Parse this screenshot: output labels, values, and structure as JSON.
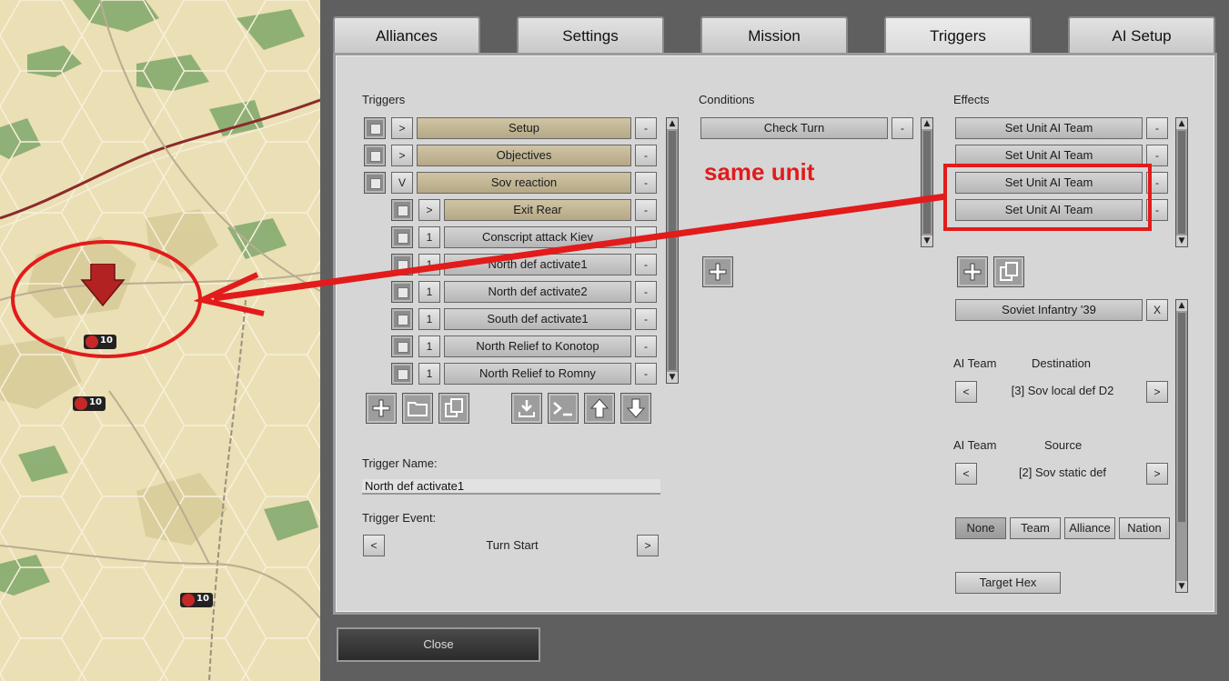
{
  "tabs": [
    {
      "label": "Alliances"
    },
    {
      "label": "Settings"
    },
    {
      "label": "Mission"
    },
    {
      "label": "Triggers"
    },
    {
      "label": "AI Setup"
    }
  ],
  "active_tab": "Triggers",
  "triggers": {
    "title": "Triggers",
    "items": [
      {
        "expander": ">",
        "label": "Setup",
        "style": "tan",
        "indent": false
      },
      {
        "expander": ">",
        "label": "Objectives",
        "style": "tan",
        "indent": false
      },
      {
        "expander": "V",
        "label": "Sov reaction",
        "style": "tan",
        "indent": false
      },
      {
        "expander": ">",
        "label": "Exit Rear",
        "style": "tan",
        "indent": true
      },
      {
        "expander": "1",
        "label": "Conscript attack Kiev",
        "style": "grey",
        "indent": true
      },
      {
        "expander": "1",
        "label": "North def activate1",
        "style": "grey",
        "indent": true
      },
      {
        "expander": "1",
        "label": "North def activate2",
        "style": "grey",
        "indent": true
      },
      {
        "expander": "1",
        "label": "South def activate1",
        "style": "grey",
        "indent": true
      },
      {
        "expander": "1",
        "label": "North Relief to Konotop",
        "style": "grey",
        "indent": true
      },
      {
        "expander": "1",
        "label": "North Relief to Romny",
        "style": "grey",
        "indent": true
      }
    ],
    "remove_label": "-",
    "name_label": "Trigger Name:",
    "name_value": "North def activate1",
    "event_label": "Trigger Event:",
    "event_value": "Turn Start",
    "prev": "<",
    "next": ">"
  },
  "conditions": {
    "title": "Conditions",
    "items": [
      {
        "label": "Check Turn"
      }
    ],
    "remove_label": "-"
  },
  "effects": {
    "title": "Effects",
    "items": [
      {
        "label": "Set Unit AI Team"
      },
      {
        "label": "Set Unit AI Team"
      },
      {
        "label": "Set Unit AI Team"
      },
      {
        "label": "Set Unit AI Team"
      }
    ],
    "remove_label": "-",
    "unit_label": "Soviet Infantry '39",
    "unit_clear": "X",
    "dest_ai_label": "AI Team",
    "dest_label": "Destination",
    "dest_value": "[3] Sov local def D2",
    "src_ai_label": "AI Team",
    "src_label": "Source",
    "src_value": "[2] Sov static def",
    "prev": "<",
    "next": ">",
    "modes": [
      "None",
      "Team",
      "Alliance",
      "Nation"
    ],
    "active_mode": "None",
    "target_hex": "Target Hex"
  },
  "close_label": "Close",
  "annotation": {
    "text": "same unit",
    "color": "#e21b1b"
  },
  "map": {
    "unit_strength": [
      "10",
      "10",
      "10"
    ]
  },
  "colors": {
    "accent_red": "#e21b1b",
    "tan_button": "#c2b694",
    "panel_bg": "#d6d6d6"
  }
}
